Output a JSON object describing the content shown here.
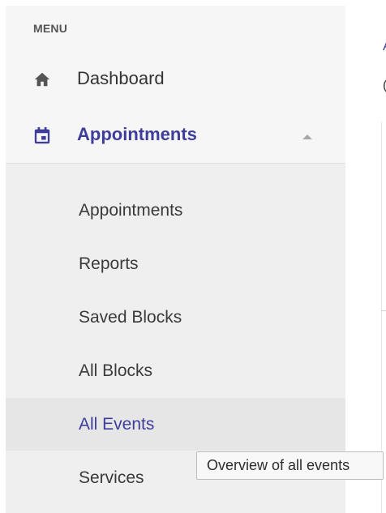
{
  "menu": {
    "header": "MENU",
    "items": [
      {
        "label": "Dashboard",
        "icon": "home-icon"
      },
      {
        "label": "Appointments",
        "icon": "calendar-icon",
        "expanded": true
      }
    ],
    "submenu": [
      {
        "label": "Appointments"
      },
      {
        "label": "Reports"
      },
      {
        "label": "Saved Blocks"
      },
      {
        "label": "All Blocks"
      },
      {
        "label": "All Events",
        "active": true
      },
      {
        "label": "Services"
      }
    ]
  },
  "tooltip": {
    "text": "Overview of all events"
  },
  "main": {
    "glyph_a": "A",
    "glyph_b": "("
  },
  "colors": {
    "accent": "#3f3d9a",
    "sidebar_bg": "#f6f6f6",
    "submenu_bg": "#efefef",
    "active_bg": "#e6e6e6"
  }
}
